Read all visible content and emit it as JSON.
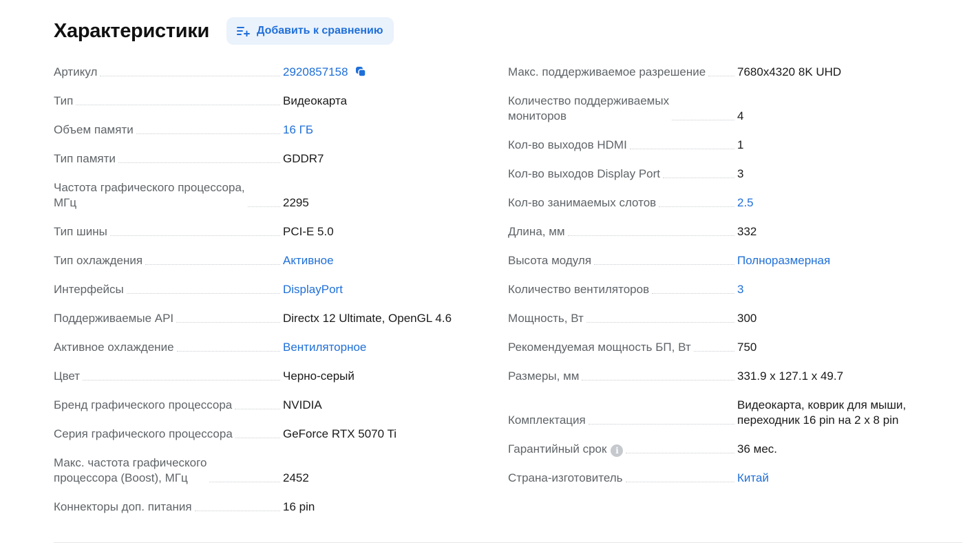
{
  "header": {
    "title": "Характеристики",
    "compare_label": "Добавить к сравнению"
  },
  "left": [
    {
      "label": "Артикул",
      "value": "2920857158",
      "link": true,
      "copy": true
    },
    {
      "label": "Тип",
      "value": "Видеокарта",
      "link": false
    },
    {
      "label": "Объем памяти",
      "value": "16 ГБ",
      "link": true
    },
    {
      "label": "Тип памяти",
      "value": "GDDR7",
      "link": false
    },
    {
      "label": "Частота графического процессора,\nМГц",
      "value": "2295",
      "link": false
    },
    {
      "label": "Тип шины",
      "value": "PCI-E 5.0",
      "link": false
    },
    {
      "label": "Тип охлаждения",
      "value": "Активное",
      "link": true
    },
    {
      "label": "Интерфейсы",
      "value": "DisplayPort",
      "link": true
    },
    {
      "label": "Поддерживаемые API",
      "value": "Directx 12 Ultimate, OpenGL 4.6",
      "link": false
    },
    {
      "label": "Активное охлаждение",
      "value": "Вентиляторное",
      "link": true
    },
    {
      "label": "Цвет",
      "value": "Черно-серый",
      "link": false
    },
    {
      "label": "Бренд графического процессора",
      "value": "NVIDIA",
      "link": false
    },
    {
      "label": "Серия графического процессора",
      "value": "GeForce RTX 5070 Ti",
      "link": false
    },
    {
      "label": "Макс. частота графического\nпроцессора (Boost), МГц",
      "value": "2452",
      "link": false
    },
    {
      "label": "Коннекторы доп. питания",
      "value": "16 pin",
      "link": false
    }
  ],
  "right": [
    {
      "label": "Макс. поддерживаемое разрешение",
      "value": "7680x4320 8K UHD",
      "link": false
    },
    {
      "label": "Количество поддерживаемых\nмониторов",
      "value": "4",
      "link": false
    },
    {
      "label": "Кол-во выходов HDMI",
      "value": "1",
      "link": false
    },
    {
      "label": "Кол-во выходов Display Port",
      "value": "3",
      "link": false
    },
    {
      "label": "Кол-во занимаемых слотов",
      "value": "2.5",
      "link": true
    },
    {
      "label": "Длина, мм",
      "value": "332",
      "link": false
    },
    {
      "label": "Высота модуля",
      "value": "Полноразмерная",
      "link": true
    },
    {
      "label": "Количество вентиляторов",
      "value": "3",
      "link": true
    },
    {
      "label": "Мощность, Вт",
      "value": "300",
      "link": false
    },
    {
      "label": "Рекомендуемая мощность БП, Вт",
      "value": "750",
      "link": false
    },
    {
      "label": "Размеры, мм",
      "value": "331.9 x 127.1 x 49.7",
      "link": false
    },
    {
      "label": "Комплектация",
      "value": "Видеокарта, коврик для мыши,\nпереходник 16 pin на 2 x 8 pin",
      "link": false
    },
    {
      "label": "Гарантийный срок",
      "value": "36 мес.",
      "link": false,
      "info": true
    },
    {
      "label": "Страна-изготовитель",
      "value": "Китай",
      "link": true
    }
  ],
  "colors": {
    "link": "#1f6fd8",
    "label": "#5f6468",
    "button_bg": "#eaf2fc"
  },
  "icons": {
    "compare": "add-to-list-icon",
    "copy": "copy-icon",
    "info": "info-icon"
  }
}
